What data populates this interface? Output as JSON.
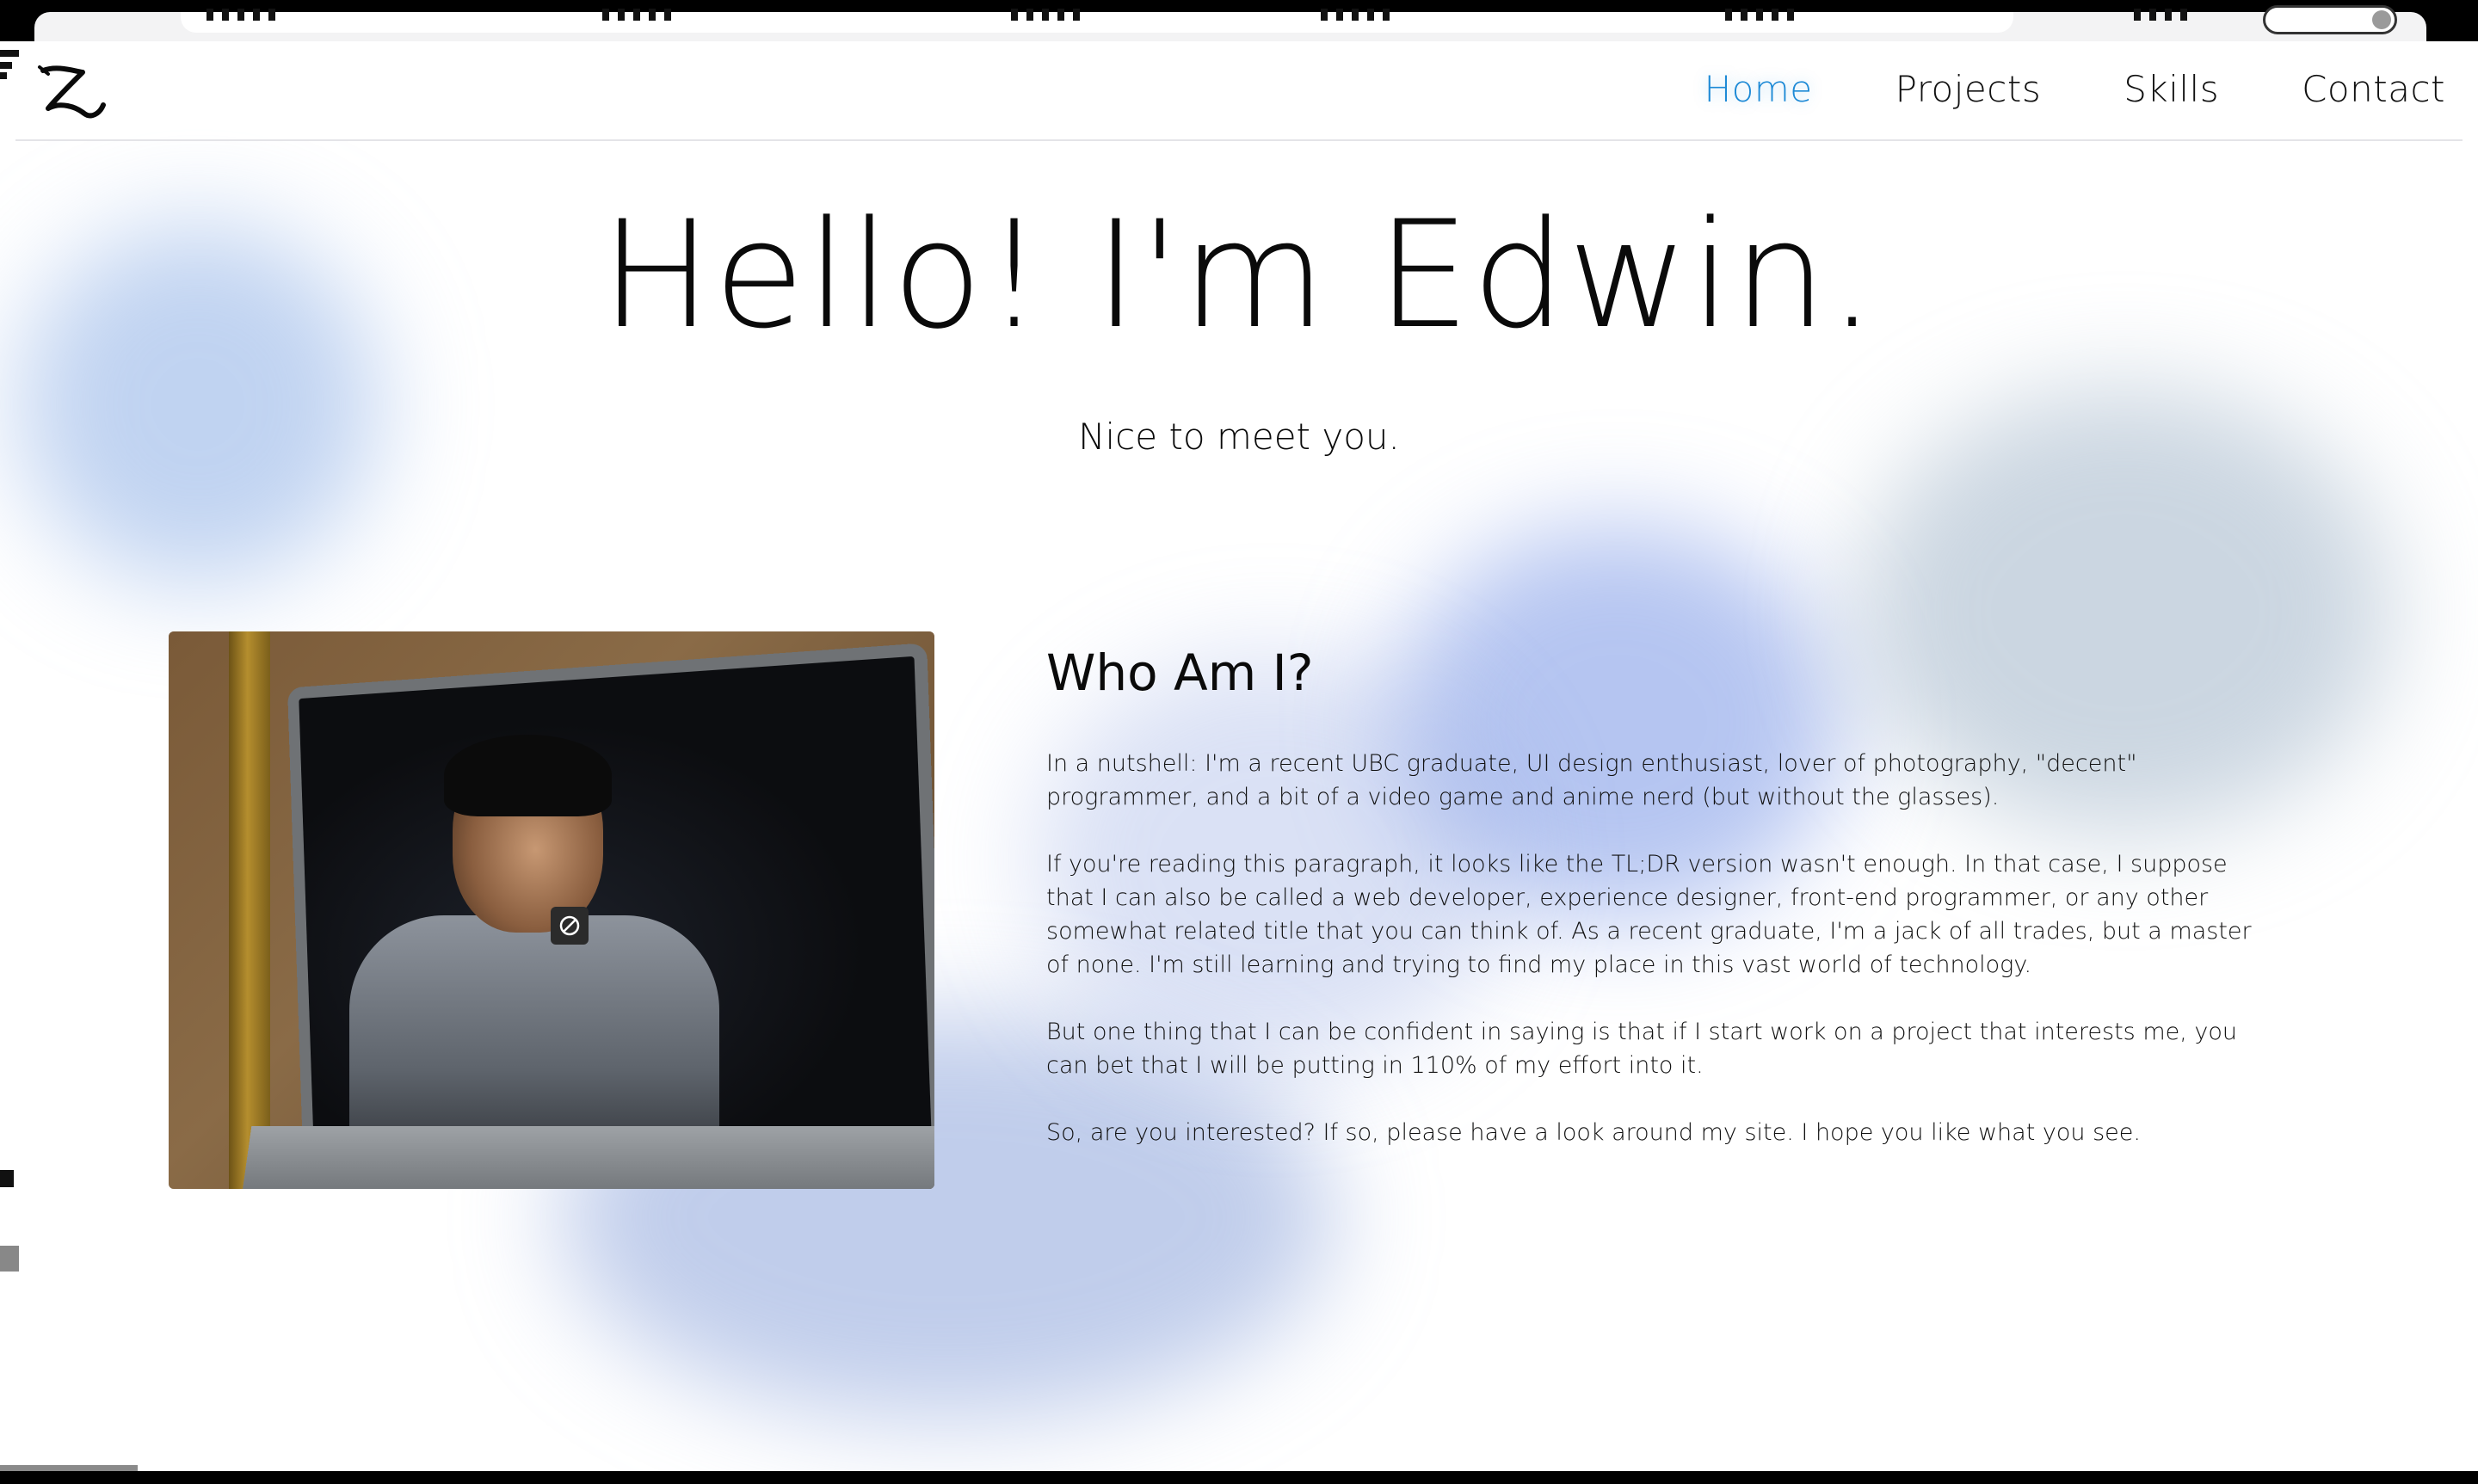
{
  "nav": {
    "logo_alt": "Z",
    "links": [
      {
        "label": "Home",
        "active": true
      },
      {
        "label": "Projects",
        "active": false
      },
      {
        "label": "Skills",
        "active": false
      },
      {
        "label": "Contact",
        "active": false
      }
    ],
    "accent_color": "#1e8ad6"
  },
  "hero": {
    "title": "Hello! I'm Edwin.",
    "subtitle": "Nice to meet you."
  },
  "about": {
    "heading": "Who Am I?",
    "paragraphs": [
      "In a nutshell: I'm a recent UBC graduate, UI design enthusiast, lover of photography, \"decent\" programmer, and a bit of a video game and anime nerd (but without the glasses).",
      "If you're reading this paragraph, it looks like the TL;DR version wasn't enough. In that case, I suppose that I can also be called a web developer, experience designer, front-end programmer, or any other somewhat related title that you can think of. As a recent graduate, I'm a jack of all trades, but a master of none. I'm still learning and trying to find my place in this vast world of technology.",
      "But one thing that I can be confident in saying is that if I start work on a project that interests me, you can bet that I will be putting in 110% of my effort into it.",
      "So, are you interested? If so, please have a look around my site. I hope you like what you see."
    ]
  },
  "photo": {
    "overlay_icon": "blocked-icon"
  }
}
